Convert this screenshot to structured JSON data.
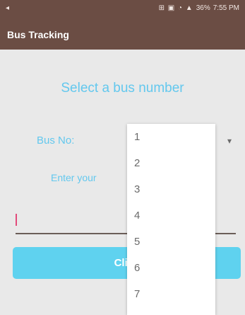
{
  "status": {
    "left_icon": "◂",
    "icons": "⊞ ▣ ◔ ▲",
    "signal_text": "36%",
    "time": "7:55 PM"
  },
  "app": {
    "title": "Bus Tracking"
  },
  "screen": {
    "heading": "Select a bus number",
    "bus_label": "Bus No:",
    "enter_label": "Enter your",
    "button_label": "Click"
  },
  "dropdown": {
    "options": [
      "1",
      "2",
      "3",
      "4",
      "5",
      "6",
      "7"
    ]
  },
  "colors": {
    "appbar": "#6b4d44",
    "accent": "#63c8ee",
    "button": "#5fd2ef",
    "cursor": "#e24a7a"
  },
  "icons": {
    "spinner_arrow": "▾"
  }
}
